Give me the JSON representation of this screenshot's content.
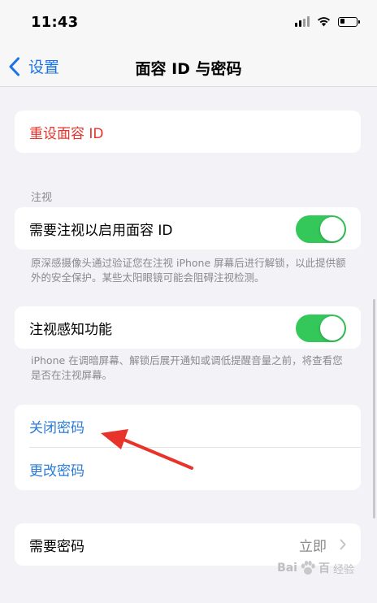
{
  "status_bar": {
    "time": "11:43"
  },
  "nav": {
    "back_label": "设置",
    "title": "面容 ID 与密码"
  },
  "reset_face_id": "重设面容 ID",
  "attention": {
    "header": "注视",
    "require_attention_label": "需要注视以启用面容 ID",
    "require_attention_on": true,
    "require_attention_footnote": "原深感摄像头通过验证您在注视 iPhone 屏幕后进行解锁，以此提供额外的安全保护。某些太阳眼镜可能会阻碍注视检测。",
    "attention_aware_label": "注视感知功能",
    "attention_aware_on": true,
    "attention_aware_footnote": "iPhone 在调暗屏幕、解锁后展开通知或调低提醒音量之前，将查看您是否在注视屏幕。"
  },
  "passcode": {
    "turn_off_label": "关闭密码",
    "change_label": "更改密码"
  },
  "require_passcode": {
    "label": "需要密码",
    "value": "立即"
  },
  "watermark": {
    "brand_left": "Bai",
    "brand_right": "百",
    "site": "经验"
  },
  "colors": {
    "accent_blue": "#2b7bd9",
    "destructive_red": "#e8332a",
    "toggle_green": "#34c759",
    "annotation_arrow": "#e8332a"
  }
}
